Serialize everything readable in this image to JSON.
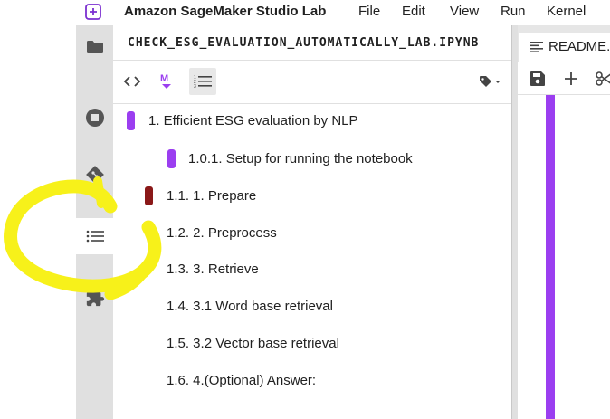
{
  "menubar": {
    "app_title": "Amazon SageMaker Studio Lab",
    "items": [
      "File",
      "Edit",
      "View",
      "Run",
      "Kernel"
    ]
  },
  "sidebar": {
    "icons": [
      "folder-icon",
      "stop-circle-icon",
      "git-icon",
      "table-of-contents-icon",
      "extension-icon"
    ],
    "active": "table-of-contents-icon"
  },
  "toc": {
    "title": "CHECK_ESG_EVALUATION_AUTOMATICALLY_LAB.IPYNB",
    "toolbar_icons": [
      "code-toggle-icon",
      "markdown-toggle-icon",
      "numbered-list-icon",
      "tag-filter-icon"
    ],
    "entries": [
      {
        "text": "1. Efficient ESG evaluation by NLP"
      },
      {
        "text": "1.0.1. Setup for running the notebook"
      },
      {
        "text": "1.1. 1. Prepare"
      },
      {
        "text": "1.2. 2. Preprocess"
      },
      {
        "text": "1.3. 3. Retrieve"
      },
      {
        "text": "1.4. 3.1 Word base retrieval"
      },
      {
        "text": "1.5. 3.2 Vector base retrieval"
      },
      {
        "text": "1.6. 4.(Optional) Answer:"
      }
    ]
  },
  "notebook": {
    "tab_label": "README.i",
    "toolbar_icons": [
      "save-icon",
      "add-cell-icon",
      "cut-icon"
    ]
  },
  "colors": {
    "accent_purple": "#9b3ef0",
    "marker_dark": "#8a1818",
    "annotation_yellow": "#f7f11a"
  }
}
